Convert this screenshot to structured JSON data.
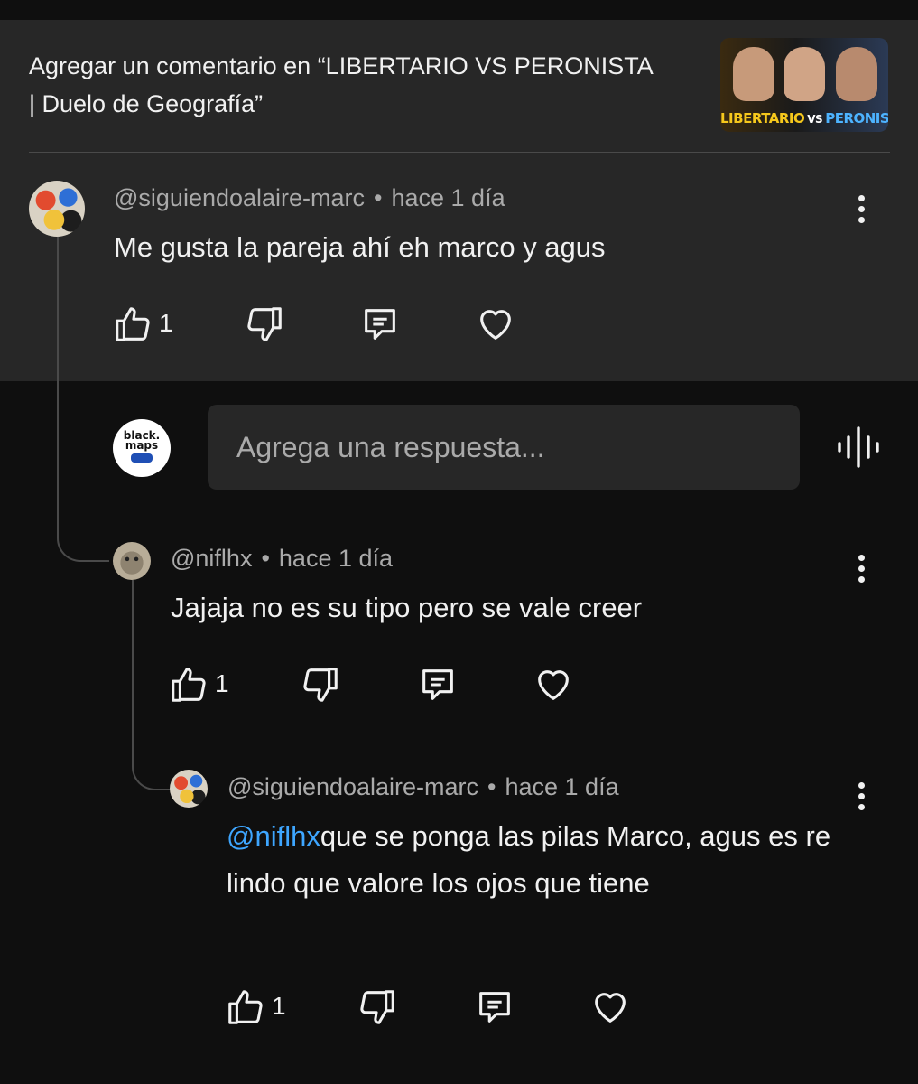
{
  "header": {
    "title": "Agregar un comentario en “LIBERTARIO VS PERONISTA | Duelo de Geografía”",
    "thumbnail": {
      "left_text": "LIBERTARIO",
      "vs_text": "VS",
      "right_text": "PERONISTA"
    }
  },
  "comments": [
    {
      "author": "@siguiendoalaire-marc",
      "time": "hace 1 día",
      "text": "Me gusta la pareja ahí eh marco y agus",
      "likes": "1"
    },
    {
      "author": "@niflhx",
      "time": "hace 1 día",
      "text": "Jajaja no es su tipo pero se vale creer",
      "likes": "1"
    },
    {
      "author": "@siguiendoalaire-marc",
      "time": "hace 1 día",
      "mention": "@niflhx",
      "text": "que se ponga las pilas Marco, agus es re lindo que valore los ojos que tiene",
      "likes": "1"
    }
  ],
  "reply": {
    "placeholder": "Agrega una respuesta...",
    "avatar_text": "black. maps"
  },
  "separator": "•",
  "icons": [
    "thumbs-up-icon",
    "thumbs-down-icon",
    "reply-icon",
    "heart-icon",
    "more-vert-icon",
    "voice-icon"
  ],
  "colors": {
    "background": "#0f0f0f",
    "panel": "#272727",
    "text": "#f1f1f1",
    "secondary": "#aaaaaa",
    "mention": "#3ea6ff"
  }
}
